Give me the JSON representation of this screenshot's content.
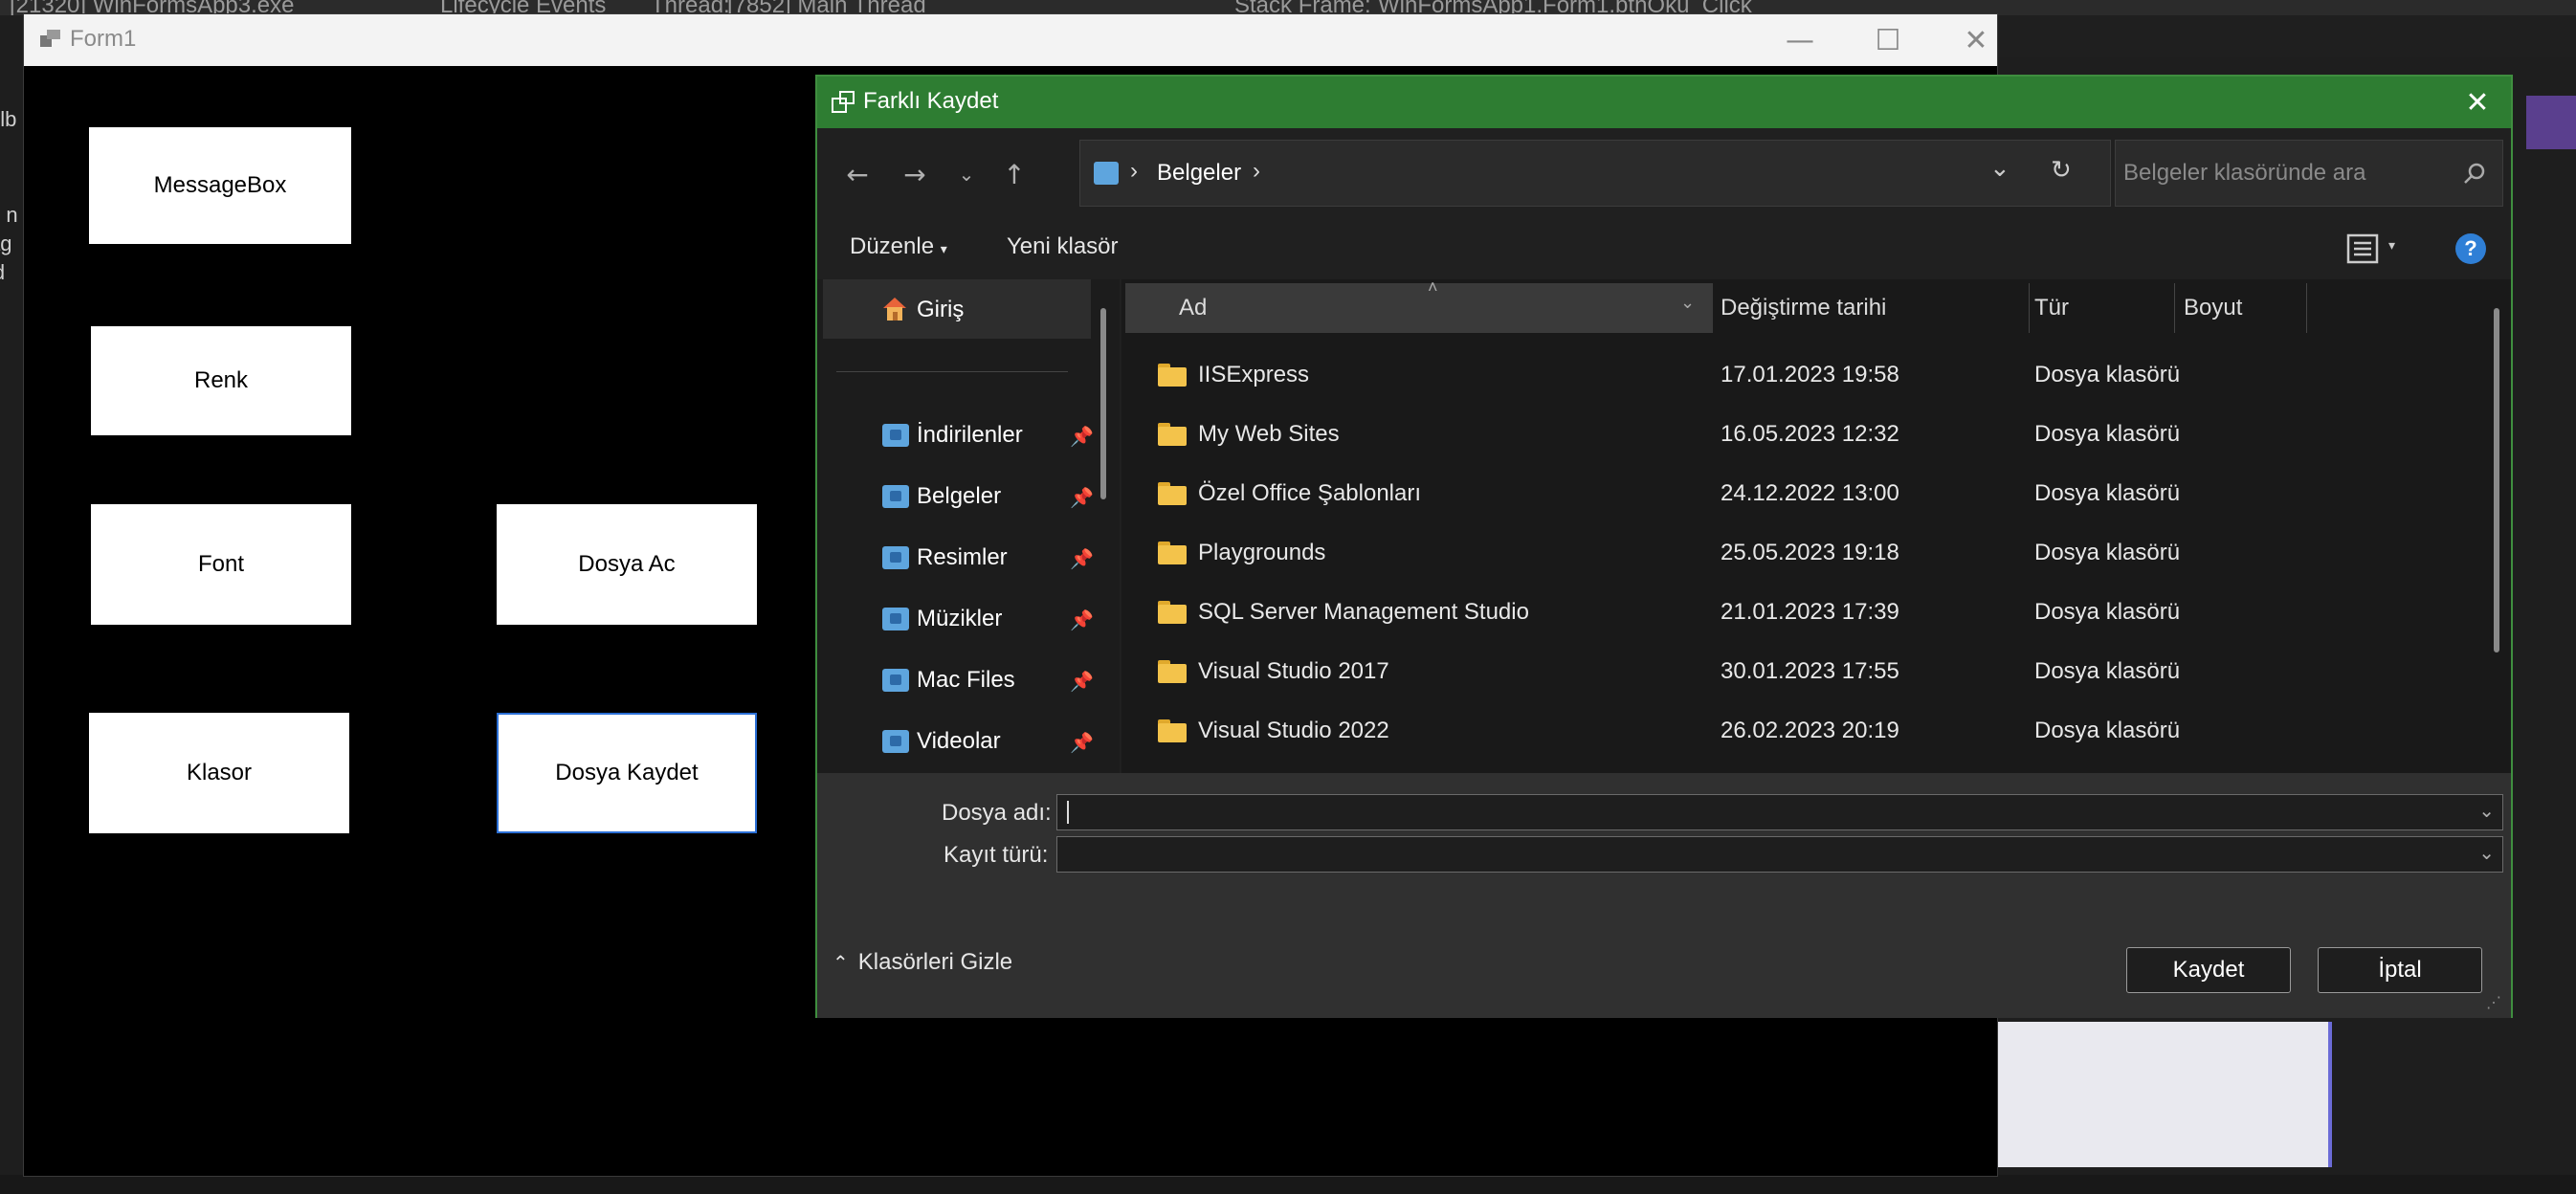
{
  "ide": {
    "topbar_process": "[21320] WinFormsApp3.exe",
    "topbar_lifecycle": "Lifecycle Events",
    "topbar_thread_label": "Thread:",
    "topbar_thread": "[7852] Main Thread",
    "topbar_stackframe_label": "Stack Frame:",
    "topbar_stackframe": "WinFormsApp1.Form1.btnOku_Click",
    "left_fragments": [
      "olb",
      "e n",
      "ag",
      "ld"
    ]
  },
  "form1": {
    "title": "Form1",
    "buttons": {
      "messagebox": "MessageBox",
      "renk": "Renk",
      "font": "Font",
      "dosya_ac": "Dosya Ac",
      "klasor": "Klasor",
      "dosya_kaydet": "Dosya Kaydet"
    }
  },
  "dialog": {
    "title": "Farklı Kaydet",
    "breadcrumb": [
      "Belgeler"
    ],
    "search_placeholder": "Belgeler klasöründe ara",
    "commands": {
      "organize": "Düzenle",
      "new_folder": "Yeni klasör"
    },
    "nav": {
      "home": "Giriş",
      "items": [
        {
          "label": "İndirilenler"
        },
        {
          "label": "Belgeler"
        },
        {
          "label": "Resimler"
        },
        {
          "label": "Müzikler"
        },
        {
          "label": "Mac Files"
        },
        {
          "label": "Videolar"
        }
      ]
    },
    "columns": {
      "name": "Ad",
      "date": "Değiştirme tarihi",
      "type": "Tür",
      "size": "Boyut"
    },
    "files": [
      {
        "name": "IISExpress",
        "date": "17.01.2023 19:58",
        "type": "Dosya klasörü"
      },
      {
        "name": "My Web Sites",
        "date": "16.05.2023 12:32",
        "type": "Dosya klasörü"
      },
      {
        "name": "Özel Office Şablonları",
        "date": "24.12.2022 13:00",
        "type": "Dosya klasörü"
      },
      {
        "name": "Playgrounds",
        "date": "25.05.2023 19:18",
        "type": "Dosya klasörü"
      },
      {
        "name": "SQL Server Management Studio",
        "date": "21.01.2023 17:39",
        "type": "Dosya klasörü"
      },
      {
        "name": "Visual Studio 2017",
        "date": "30.01.2023 17:55",
        "type": "Dosya klasörü"
      },
      {
        "name": "Visual Studio 2022",
        "date": "26.02.2023 20:19",
        "type": "Dosya klasörü"
      }
    ],
    "filename_label": "Dosya adı:",
    "filename_value": "",
    "filetype_label": "Kayıt türü:",
    "filetype_value": "",
    "hide_folders": "Klasörleri Gizle",
    "save": "Kaydet",
    "cancel": "İptal"
  }
}
